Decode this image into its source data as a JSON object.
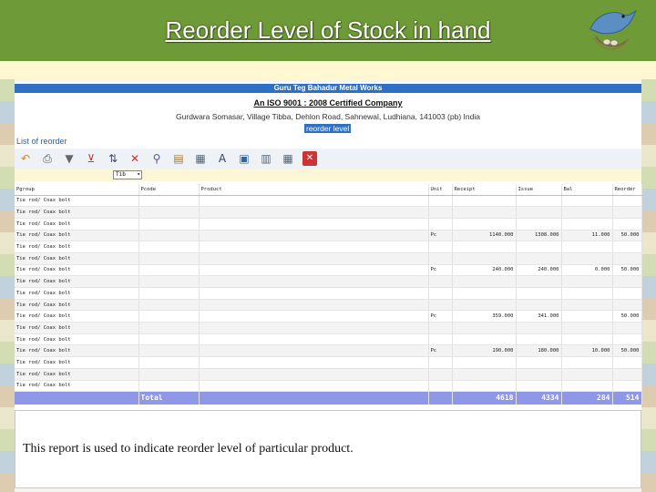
{
  "slide": {
    "title": "Reorder Level of Stock in hand",
    "caption": "This report is used to indicate reorder level of particular product."
  },
  "report": {
    "company": "Guru Teg Bahadur Metal Works",
    "certification": "An ISO 9001 : 2008 Certified Company",
    "address": "Gurdwara Somasar, Village Tibba, Dehlon Road, Sahnewal, Ludhiana, 141003 (pb) India",
    "report_name": "reorder level",
    "list_label": "List of reorder",
    "filter_value": "Tib",
    "columns": [
      "Pgroup",
      "Pcode",
      "Product",
      "Unit",
      "Receipt",
      "Issue",
      "Bal",
      "Reorder"
    ],
    "rows": [
      [
        "Tie rod/ Coax bolt",
        "",
        "",
        "",
        "",
        "",
        "",
        ""
      ],
      [
        "Tie rod/ Coax bolt",
        "",
        "",
        "",
        "",
        "",
        "",
        ""
      ],
      [
        "Tie rod/ Coax bolt",
        "",
        "",
        "",
        "",
        "",
        "",
        ""
      ],
      [
        "Tie rod/ Coax bolt",
        "",
        "",
        "Pc",
        "1140.000",
        "1308.000",
        "11.000",
        "50.000"
      ],
      [
        "Tie rod/ Coax bolt",
        "",
        "",
        "",
        "",
        "",
        "",
        ""
      ],
      [
        "Tie rod/ Coax bolt",
        "",
        "",
        "",
        "",
        "",
        "",
        ""
      ],
      [
        "Tie rod/ Coax bolt",
        "",
        "",
        "Pc",
        "240.000",
        "240.000",
        "0.000",
        "50.000"
      ],
      [
        "Tie rod/ Coax bolt",
        "",
        "",
        "",
        "",
        "",
        "",
        ""
      ],
      [
        "Tie rod/ Coax bolt",
        "",
        "",
        "",
        "",
        "",
        "",
        ""
      ],
      [
        "Tie rod/ Coax bolt",
        "",
        "",
        "",
        "",
        "",
        "",
        ""
      ],
      [
        "Tie rod/ Coax bolt",
        "",
        "",
        "Pc",
        "359.000",
        "341.000",
        "",
        "50.000"
      ],
      [
        "Tie rod/ Coax bolt",
        "",
        "",
        "",
        "",
        "",
        "",
        ""
      ],
      [
        "Tie rod/ Coax bolt",
        "",
        "",
        "",
        "",
        "",
        "",
        ""
      ],
      [
        "Tie rod/ Coax bolt",
        "",
        "",
        "Pc",
        "190.000",
        "180.000",
        "10.000",
        "50.000"
      ],
      [
        "Tie rod/ Coax bolt",
        "",
        "",
        "",
        "",
        "",
        "",
        ""
      ],
      [
        "Tie rod/ Coax bolt",
        "",
        "",
        "",
        "",
        "",
        "",
        ""
      ],
      [
        "Tie rod/ Coax bolt",
        "",
        "",
        "",
        "",
        "",
        "",
        ""
      ]
    ],
    "totals": {
      "label": "Total",
      "receipt": "4618",
      "issue": "4334",
      "bal": "284",
      "reorder": "514"
    }
  },
  "toolbar_icons": [
    "refresh-icon",
    "print-icon",
    "filter-icon",
    "clear-filter-icon",
    "sort-icon",
    "remove-sort-icon",
    "search-icon",
    "export-icon",
    "grid-icon",
    "font-icon",
    "document-icon",
    "columns-icon",
    "table-icon",
    "close-icon"
  ],
  "colors": {
    "header_green": "#6e9a38",
    "company_bar_blue": "#2f6fc4",
    "total_row": "#8f97e6"
  }
}
